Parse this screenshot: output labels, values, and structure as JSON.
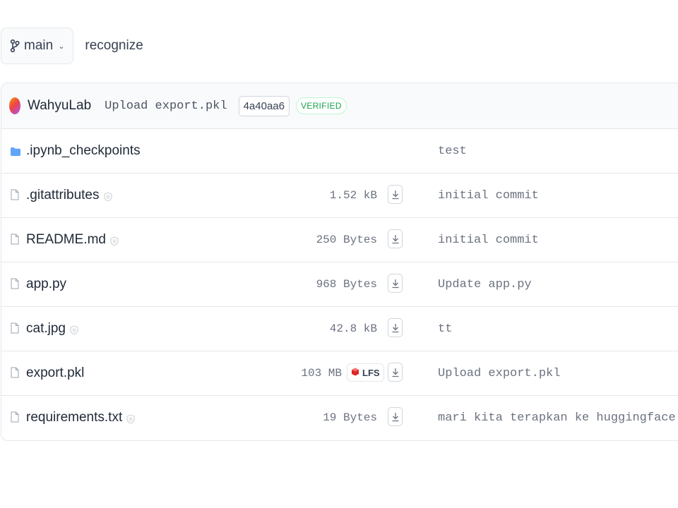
{
  "topbar": {
    "branch_label": "main",
    "repo_name": "recognize"
  },
  "commit": {
    "author": "WahyuLab",
    "message": "Upload export.pkl",
    "hash": "4a40aa6",
    "verified": "VERIFIED"
  },
  "files": [
    {
      "name": ".ipynb_checkpoints",
      "type": "folder",
      "size": "",
      "commit": "test"
    },
    {
      "name": ".gitattributes",
      "type": "file",
      "size": "1.52 kB",
      "commit": "initial commit"
    },
    {
      "name": "README.md",
      "type": "file",
      "size": "250 Bytes",
      "commit": "initial commit"
    },
    {
      "name": "app.py",
      "type": "file",
      "size": "968 Bytes",
      "commit": "Update app.py"
    },
    {
      "name": "cat.jpg",
      "type": "file",
      "size": "42.8 kB",
      "commit": "tt"
    },
    {
      "name": "export.pkl",
      "type": "file",
      "size": "103 MB",
      "lfs": "LFS",
      "commit": "Upload export.pkl"
    },
    {
      "name": "requirements.txt",
      "type": "file",
      "size": "19 Bytes",
      "commit": "mari kita terapkan ke huggingface spaces"
    }
  ],
  "colors": {
    "folder": "#60a5fa",
    "verified": "#16a34a",
    "lfs_icon": "#dc2626"
  }
}
